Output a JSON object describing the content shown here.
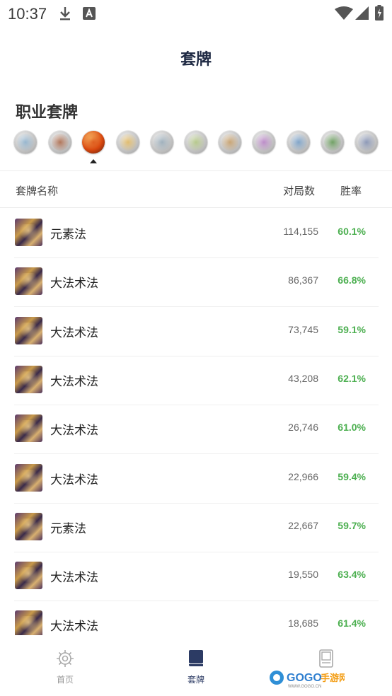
{
  "status": {
    "time": "10:37"
  },
  "header": {
    "title": "套牌"
  },
  "section": {
    "title": "职业套牌"
  },
  "classes": [
    {
      "icon": "class-icon-1",
      "color": "#7fa8c8",
      "selected": false
    },
    {
      "icon": "class-icon-2",
      "color": "#a0522d",
      "selected": false
    },
    {
      "icon": "class-icon-3",
      "color": "#d9480f",
      "selected": true
    },
    {
      "icon": "class-icon-4",
      "color": "#e0b04a",
      "selected": false
    },
    {
      "icon": "class-icon-5",
      "color": "#8aa0b0",
      "selected": false
    },
    {
      "icon": "class-icon-6",
      "color": "#a8c070",
      "selected": false
    },
    {
      "icon": "class-icon-7",
      "color": "#c09050",
      "selected": false
    },
    {
      "icon": "class-icon-8",
      "color": "#b070c0",
      "selected": false
    },
    {
      "icon": "class-icon-9",
      "color": "#6090c0",
      "selected": false
    },
    {
      "icon": "class-icon-10",
      "color": "#4a8a3a",
      "selected": false
    },
    {
      "icon": "class-icon-11",
      "color": "#7080a8",
      "selected": false
    }
  ],
  "table": {
    "headers": {
      "name": "套牌名称",
      "games": "对局数",
      "winrate": "胜率"
    },
    "rows": [
      {
        "name": "元素法",
        "games": "114,155",
        "winrate": "60.1%"
      },
      {
        "name": "大法术法",
        "games": "86,367",
        "winrate": "66.8%"
      },
      {
        "name": "大法术法",
        "games": "73,745",
        "winrate": "59.1%"
      },
      {
        "name": "大法术法",
        "games": "43,208",
        "winrate": "62.1%"
      },
      {
        "name": "大法术法",
        "games": "26,746",
        "winrate": "61.0%"
      },
      {
        "name": "大法术法",
        "games": "22,966",
        "winrate": "59.4%"
      },
      {
        "name": "元素法",
        "games": "22,667",
        "winrate": "59.7%"
      },
      {
        "name": "大法术法",
        "games": "19,550",
        "winrate": "63.4%"
      },
      {
        "name": "大法术法",
        "games": "18,685",
        "winrate": "61.4%"
      }
    ]
  },
  "nav": {
    "home": "首页",
    "decks": "套牌",
    "active_color": "#2c3b64",
    "inactive_color": "#999999"
  },
  "watermark": {
    "text": "GOGO手游网",
    "url": "WWW.GOGO.CN"
  }
}
